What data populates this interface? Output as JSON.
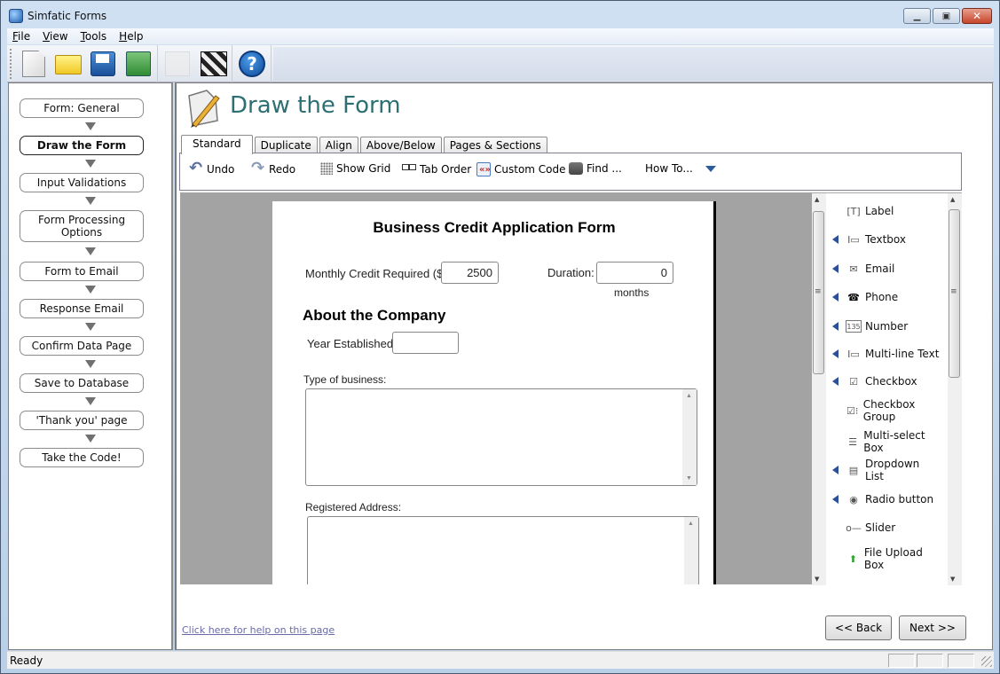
{
  "window": {
    "title": "Simfatic Forms",
    "controls": [
      "minimize",
      "maximize",
      "close"
    ]
  },
  "menu": [
    {
      "label": "File",
      "accel": "F"
    },
    {
      "label": "View",
      "accel": "V"
    },
    {
      "label": "Tools",
      "accel": "T"
    },
    {
      "label": "Help",
      "accel": "H"
    }
  ],
  "toolbar": {
    "buttons": [
      {
        "name": "new",
        "icon": "new-document-icon"
      },
      {
        "name": "open",
        "icon": "open-folder-icon"
      },
      {
        "name": "save",
        "icon": "save-disk-icon"
      },
      {
        "name": "save-as",
        "icon": "save-as-icon"
      },
      {
        "name": "tools",
        "icon": "wrench-icon",
        "disabled": true
      },
      {
        "name": "preview",
        "icon": "clapperboard-icon"
      },
      {
        "name": "help",
        "icon": "help-circle-icon",
        "glyph": "?"
      }
    ]
  },
  "steps": [
    {
      "label": "Form: General",
      "active": false
    },
    {
      "label": "Draw the Form",
      "active": true
    },
    {
      "label": "Input Validations",
      "active": false
    },
    {
      "label": "Form Processing Options",
      "active": false
    },
    {
      "label": "Form to Email",
      "active": false
    },
    {
      "label": "Response Email",
      "active": false
    },
    {
      "label": "Confirm Data Page",
      "active": false
    },
    {
      "label": "Save to Database",
      "active": false
    },
    {
      "label": "'Thank you' page",
      "active": false
    },
    {
      "label": "Take the Code!",
      "active": false
    }
  ],
  "page": {
    "title": "Draw the Form",
    "tabs": [
      "Standard",
      "Duplicate",
      "Align",
      "Above/Below",
      "Pages & Sections"
    ],
    "active_tab": "Standard",
    "actions": {
      "undo": "Undo",
      "redo": "Redo",
      "show_grid": "Show Grid",
      "tab_order": "Tab Order",
      "custom_code": "Custom Code",
      "find": "Find ...",
      "how_to": "How To..."
    }
  },
  "form": {
    "title": "Business Credit Application Form",
    "monthly_credit_label": "Monthly Credit Required ($):",
    "monthly_credit_value": "2500",
    "duration_label": "Duration:",
    "duration_value": "0",
    "duration_unit": "months",
    "section_heading": "About the Company",
    "year_label": "Year Established:",
    "year_value": "",
    "business_type_label": "Type of business:",
    "address_label": "Registered Address:"
  },
  "toolbox": [
    {
      "label": "Label",
      "icon": "[T]",
      "marker": false
    },
    {
      "label": "Textbox",
      "icon": "I▭",
      "marker": true
    },
    {
      "label": "Email",
      "icon": "✉",
      "marker": true
    },
    {
      "label": "Phone",
      "icon": "☎",
      "marker": true
    },
    {
      "label": "Number",
      "icon": "135",
      "marker": true
    },
    {
      "label": "Multi-line Text",
      "icon": "I▭",
      "marker": true
    },
    {
      "label": "Checkbox",
      "icon": "☑",
      "marker": true
    },
    {
      "label": "Checkbox Group",
      "icon": "☑⁝",
      "marker": false
    },
    {
      "label": "Multi-select Box",
      "icon": "☰",
      "marker": false
    },
    {
      "label": "Dropdown List",
      "icon": "▤",
      "marker": true
    },
    {
      "label": "Radio button",
      "icon": "◉",
      "marker": true
    },
    {
      "label": "Slider",
      "icon": "o—",
      "marker": false
    },
    {
      "label": "File Upload Box",
      "icon": "⬆",
      "marker": false
    }
  ],
  "footer": {
    "help_link": "Click here for help on this page",
    "back": "<< Back",
    "next": "Next >>"
  },
  "status": {
    "text": "Ready"
  }
}
